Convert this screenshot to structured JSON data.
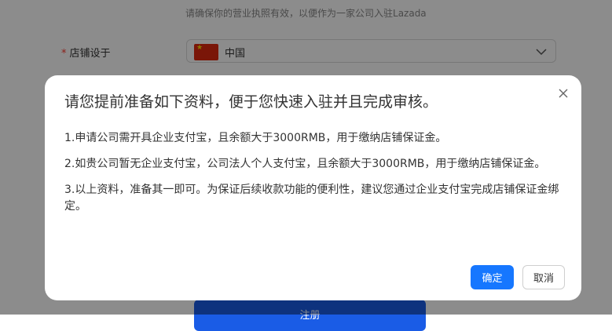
{
  "background": {
    "hint_text": "请确保你的营业执照有效，以便作为一家公司入驻Lazada",
    "store_location": {
      "required_mark": "*",
      "label": "店铺设于",
      "value": "中国"
    },
    "submit_label": "注册"
  },
  "modal": {
    "title": "请您提前准备如下资料，便于您快速入驻并且完成审核。",
    "items": [
      "1.申请公司需开具企业支付宝，且余额大于3000RMB，用于缴纳店铺保证金。",
      "2.如贵公司暂无企业支付宝，公司法人个人支付宝，且余额大于3000RMB，用于缴纳店铺保证金。",
      "3.以上资料，准备其一即可。为保证后续收款功能的便利性，建议您通过企业支付宝完成店铺保证金绑定。"
    ],
    "confirm_label": "确定",
    "cancel_label": "取消"
  },
  "colors": {
    "primary": "#1677ff",
    "required": "#ff3b30",
    "overlay": "rgba(0,0,0,0.45)"
  },
  "icons": {
    "close": "close-icon",
    "dropdown": "chevron-down-icon",
    "flag": "china-flag-icon"
  }
}
